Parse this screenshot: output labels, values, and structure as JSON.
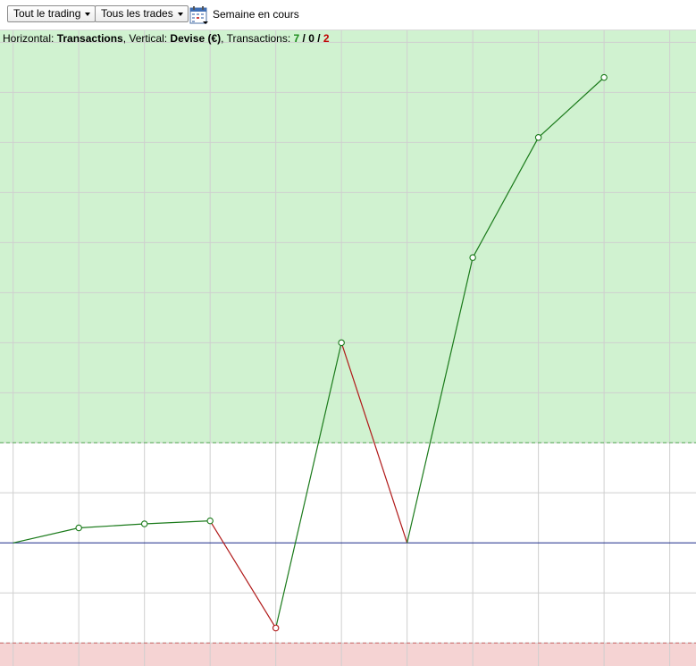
{
  "toolbar": {
    "trading_select": "Tout le trading",
    "trades_select": "Tous les trades",
    "calendar_icon": "calendar-icon",
    "period_label": "Semaine en cours"
  },
  "info": {
    "horizontal_prefix": "Horizontal: ",
    "horizontal_value": "Transactions",
    "vertical_prefix": ", Vertical: ",
    "vertical_value": "Devise (€)",
    "transactions_prefix": ", Transactions: ",
    "wins": "7",
    "sep1": " / ",
    "even": "0",
    "sep2": " / ",
    "losses": "2"
  },
  "colors": {
    "profit_zone": "#d0f2d0",
    "loss_zone": "#f5d3d3",
    "up_segment": "#1a7a1a",
    "down_segment": "#b01818",
    "baseline": "#1a2a8a",
    "grid": "#cfcfcf"
  },
  "chart_data": {
    "type": "line",
    "x": [
      0,
      1,
      2,
      3,
      4,
      5,
      6,
      7,
      8,
      9
    ],
    "y": [
      0,
      0.15,
      0.19,
      0.22,
      -0.85,
      2.0,
      0,
      2.85,
      4.05,
      4.65
    ],
    "upper_zone_threshold": 1.0,
    "lower_zone_threshold": -1.0,
    "xlim": [
      -0.2,
      10.4
    ],
    "ylim": [
      -1.23,
      5.12
    ],
    "grid": true
  }
}
